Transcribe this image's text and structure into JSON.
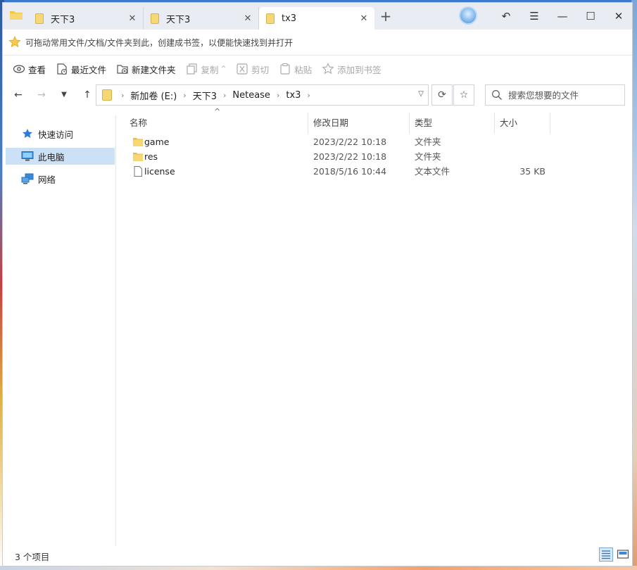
{
  "tabs": [
    {
      "label": "天下3",
      "active": false
    },
    {
      "label": "天下3",
      "active": false
    },
    {
      "label": "tx3",
      "active": true
    }
  ],
  "bookmark_bar": {
    "hint": "可拖动常用文件/文档/文件夹到此，创建成书签，以便能快速找到并打开"
  },
  "toolbar": {
    "view": "查看",
    "recent": "最近文件",
    "new_folder": "新建文件夹",
    "copy": "复制",
    "cut": "剪切",
    "paste": "粘贴",
    "add_bookmark": "添加到书签"
  },
  "address": {
    "crumbs": [
      "新加卷 (E:)",
      "天下3",
      "Netease",
      "tx3"
    ]
  },
  "search": {
    "placeholder": "搜索您想要的文件"
  },
  "sidebar": {
    "items": [
      {
        "label": "快速访问",
        "icon": "star-icon"
      },
      {
        "label": "此电脑",
        "icon": "computer-icon",
        "selected": true
      },
      {
        "label": "网络",
        "icon": "network-icon"
      }
    ]
  },
  "columns": {
    "name": "名称",
    "date": "修改日期",
    "type": "类型",
    "size": "大小"
  },
  "files": [
    {
      "name": "game",
      "date": "2023/2/22 10:18",
      "type": "文件夹",
      "size": "",
      "icon": "folder-icon"
    },
    {
      "name": "res",
      "date": "2023/2/22 10:18",
      "type": "文件夹",
      "size": "",
      "icon": "folder-icon"
    },
    {
      "name": "license",
      "date": "2018/5/16 10:44",
      "type": "文本文件",
      "size": "35 KB",
      "icon": "file-icon"
    }
  ],
  "status": {
    "count": "3 个项目"
  },
  "colors": {
    "folder": "#f7d774",
    "selection": "#cce1f5",
    "accent": "#3d86d3"
  }
}
